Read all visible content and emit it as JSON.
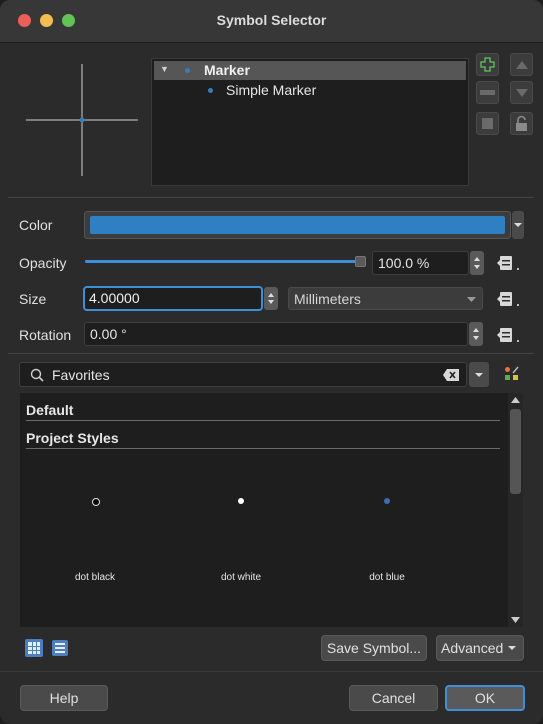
{
  "window": {
    "title": "Symbol Selector"
  },
  "tree": {
    "items": [
      {
        "label": "Marker"
      },
      {
        "label": "Simple Marker"
      }
    ]
  },
  "props": {
    "color_label": "Color",
    "color_value": "#2f7fc3",
    "opacity_label": "Opacity",
    "opacity_value": "100.0 %",
    "opacity_fraction": 1.0,
    "size_label": "Size",
    "size_value": "4.00000",
    "size_unit": "Millimeters",
    "rotation_label": "Rotation",
    "rotation_value": "0.00 °"
  },
  "search": {
    "value": "Favorites"
  },
  "library": {
    "sections": [
      "Default",
      "Project Styles"
    ],
    "symbols": [
      {
        "label": "dot  black"
      },
      {
        "label": "dot  white"
      },
      {
        "label": "dot blue"
      }
    ]
  },
  "footer": {
    "save_label": "Save Symbol...",
    "advanced_label": "Advanced",
    "help_label": "Help",
    "cancel_label": "Cancel",
    "ok_label": "OK"
  }
}
